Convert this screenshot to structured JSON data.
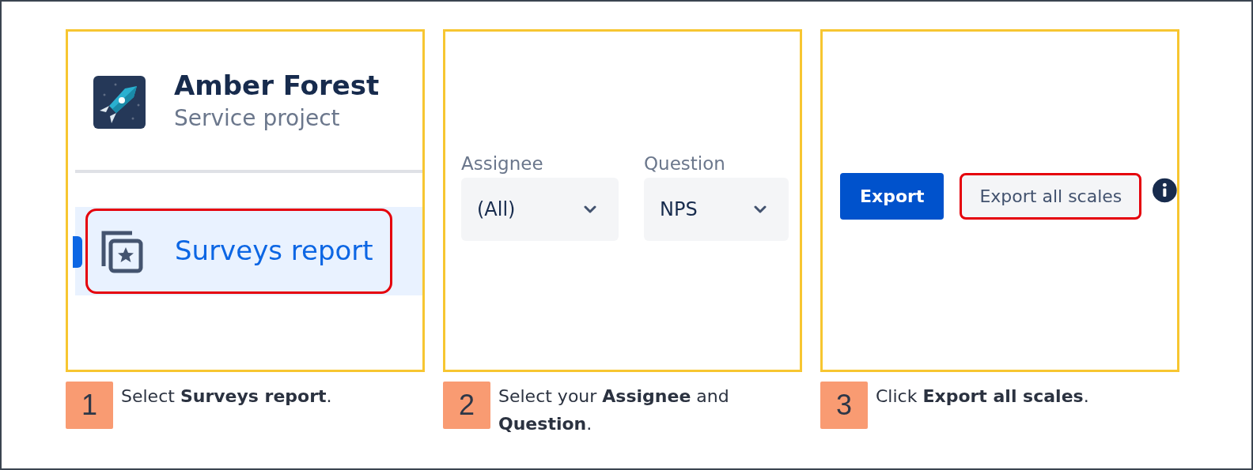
{
  "steps": [
    {
      "number": "1",
      "caption": "Select **Surveys report**.",
      "panel": {
        "kind": "sidebar",
        "project_name": "Amber Forest",
        "project_type": "Service project",
        "nav_item": {
          "label": "Surveys report",
          "selected": true,
          "highlighted": true
        }
      }
    },
    {
      "number": "2",
      "caption": "Select your **Assignee** and **Question**.",
      "panel": {
        "kind": "filters",
        "filters": [
          {
            "label": "Assignee",
            "value": "(All)"
          },
          {
            "label": "Question",
            "value": "NPS"
          }
        ]
      }
    },
    {
      "number": "3",
      "caption": "Click **Export all scales**.",
      "panel": {
        "kind": "export",
        "buttons": [
          {
            "label": "Export",
            "kind": "primary",
            "highlighted": false
          },
          {
            "label": "Export all scales",
            "kind": "secondary",
            "highlighted": true
          }
        ]
      }
    }
  ]
}
